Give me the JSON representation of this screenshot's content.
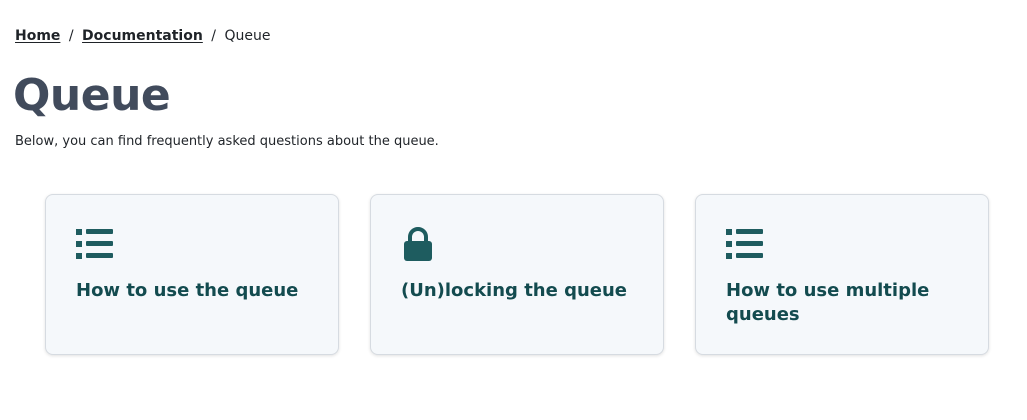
{
  "breadcrumb": {
    "home": "Home",
    "documentation": "Documentation",
    "current": "Queue",
    "separator": "/"
  },
  "page": {
    "title": "Queue",
    "intro": "Below, you can find frequently asked questions about the queue."
  },
  "cards": [
    {
      "label": "How to use the queue",
      "icon": "list-icon"
    },
    {
      "label": "(Un)locking the queue",
      "icon": "lock-icon"
    },
    {
      "label": "How to use multiple queues",
      "icon": "list-icon"
    }
  ],
  "colors": {
    "title": "#414b5c",
    "card_text": "#134b4f",
    "icon": "#1e5c5f",
    "card_bg": "#f5f8fb",
    "card_border": "#d6dbe1"
  }
}
